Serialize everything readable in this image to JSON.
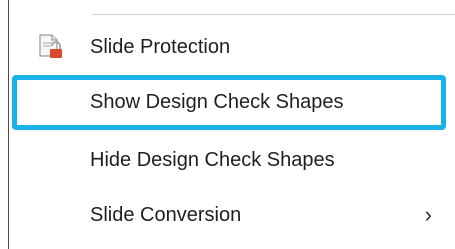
{
  "menu": {
    "items": [
      {
        "label": "Slide Protection",
        "icon": "slide-protection-icon"
      },
      {
        "label": "Show Design Check Shapes",
        "highlighted": true
      },
      {
        "label": "Hide Design Check Shapes"
      },
      {
        "label": "Slide Conversion",
        "submenu_arrow": "›"
      }
    ]
  },
  "colors": {
    "highlight_border": "#19b2e6",
    "text": "#1f1f1f",
    "icon_accent": "#d84a2f"
  }
}
